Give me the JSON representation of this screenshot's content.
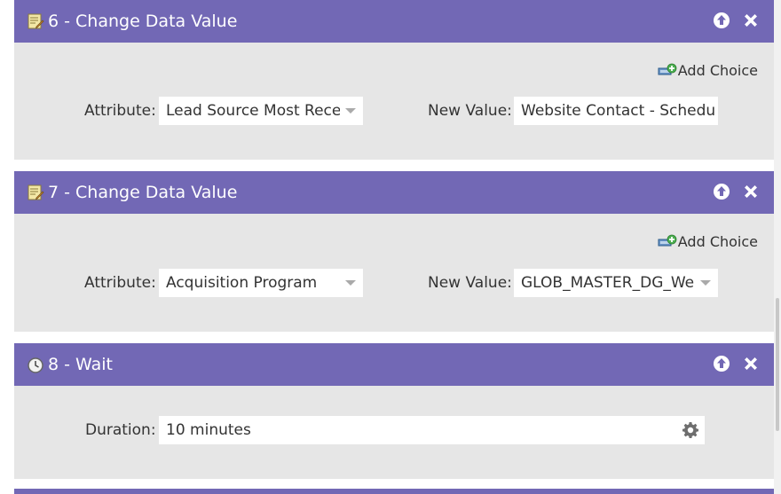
{
  "steps": [
    {
      "title": "6 - Change Data Value",
      "icon": "edit-document-icon",
      "add_choice_label": "Add Choice",
      "attribute_label": "Attribute:",
      "attribute_value": "Lead Source Most Rece",
      "new_value_label": "New Value:",
      "new_value_value": "Website Contact - Schedule"
    },
    {
      "title": "7 - Change Data Value",
      "icon": "edit-document-icon",
      "add_choice_label": "Add Choice",
      "attribute_label": "Attribute:",
      "attribute_value": "Acquisition Program",
      "new_value_label": "New Value:",
      "new_value_value": "GLOB_MASTER_DG_Wel"
    },
    {
      "title": "8 - Wait",
      "icon": "clock-icon",
      "duration_label": "Duration:",
      "duration_value": "10 minutes"
    }
  ],
  "icons": {
    "move_up": "arrow-up-circle-icon",
    "delete": "close-x-icon",
    "add_choice": "add-choice-icon",
    "settings": "gear-icon",
    "dropdown": "chevron-down-icon"
  },
  "colors": {
    "header_bg": "#7268b5",
    "body_bg": "#e6e6e6",
    "field_bg": "#ffffff",
    "text": "#333333",
    "header_text": "#ffffff"
  }
}
